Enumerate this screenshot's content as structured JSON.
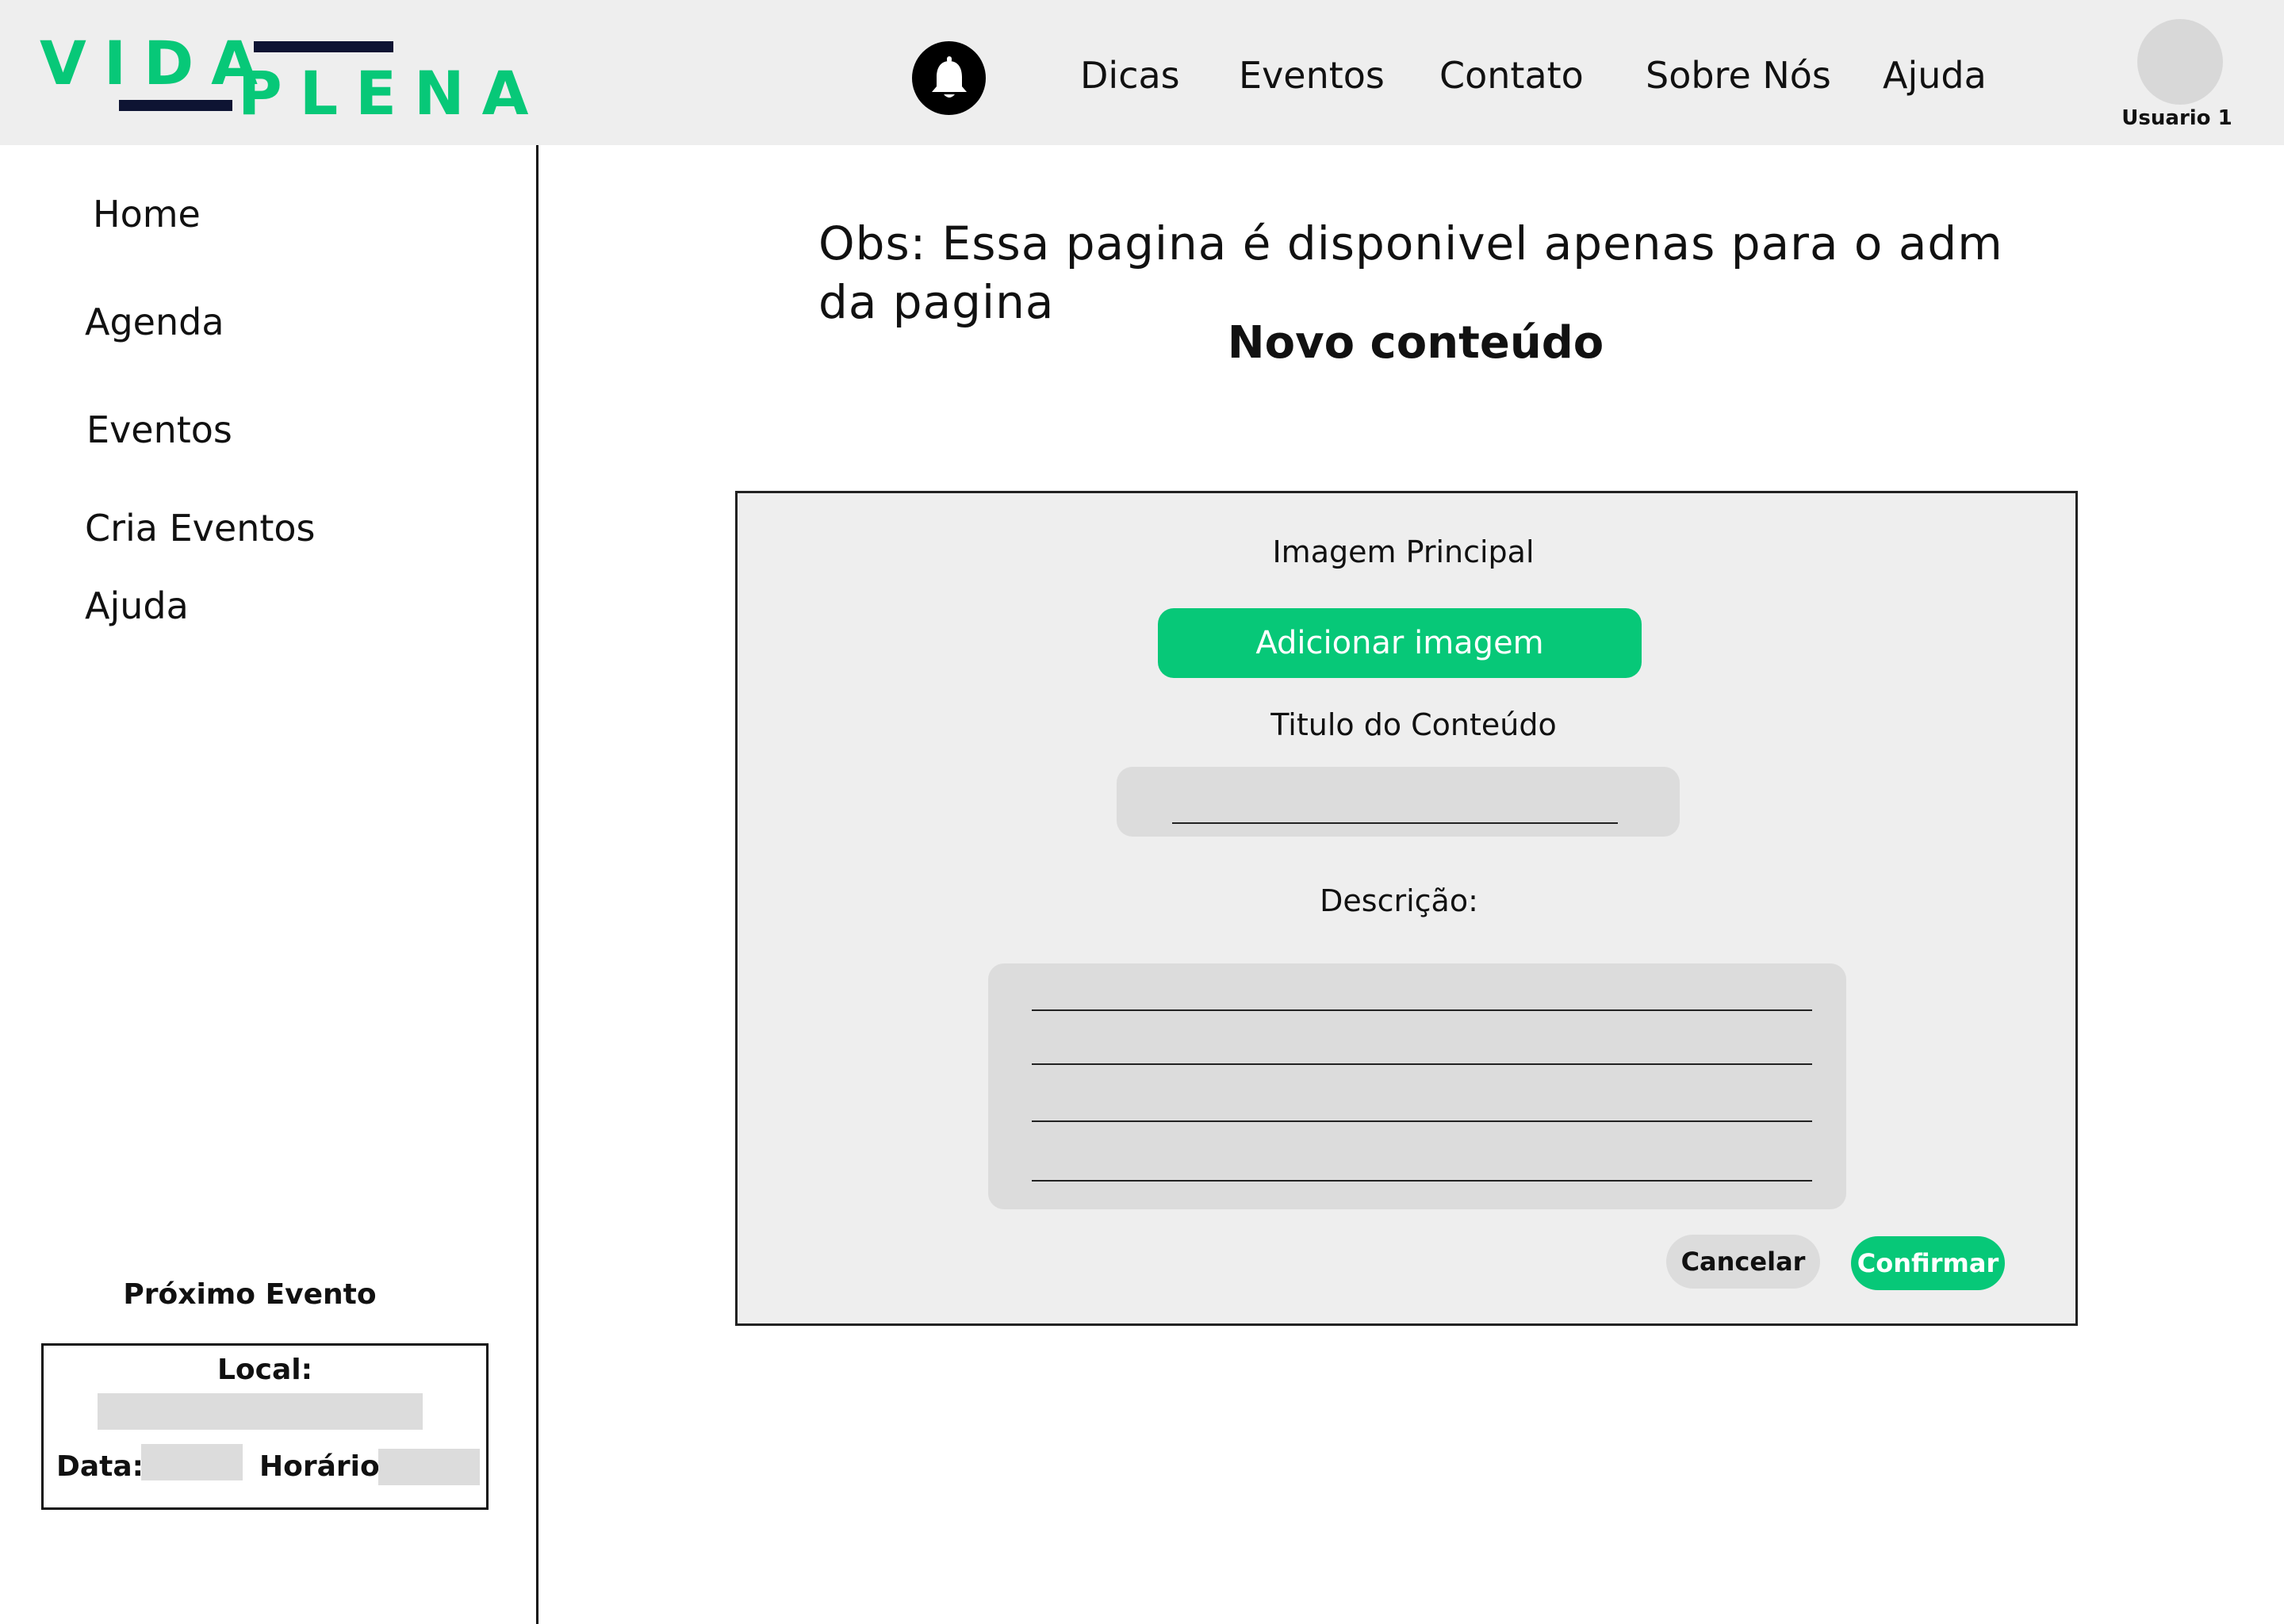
{
  "header": {
    "logo": {
      "word1": "VIDA",
      "word2": "PLENA",
      "brand_green": "#07c878",
      "brand_navy": "#0e1433"
    },
    "notification_icon": "bell-icon",
    "nav": [
      "Dicas",
      "Eventos",
      "Contato",
      "Sobre Nós",
      "Ajuda"
    ],
    "user": {
      "name": "Usuario 1"
    }
  },
  "sidebar": {
    "items": [
      "Home",
      "Agenda",
      "Eventos",
      "Cria Eventos",
      "Ajuda"
    ],
    "next_event": {
      "title": "Próximo Evento",
      "local_label": "Local:",
      "data_label": "Data:",
      "horario_label": "Horário:"
    }
  },
  "main": {
    "notice": "Obs: Essa pagina é disponivel apenas para o adm da pagina",
    "title": "Novo conteúdo",
    "form": {
      "image_label": "Imagem Principal",
      "add_image_button": "Adicionar imagem",
      "title_label": "Titulo do Conteúdo",
      "description_label": "Descrição:",
      "cancel_button": "Cancelar",
      "confirm_button": "Confirmar"
    }
  },
  "colors": {
    "header_bg": "#eeeeee",
    "panel_bg": "#eeeeee",
    "field_bg": "#dcdcdc",
    "accent": "#07c878"
  }
}
